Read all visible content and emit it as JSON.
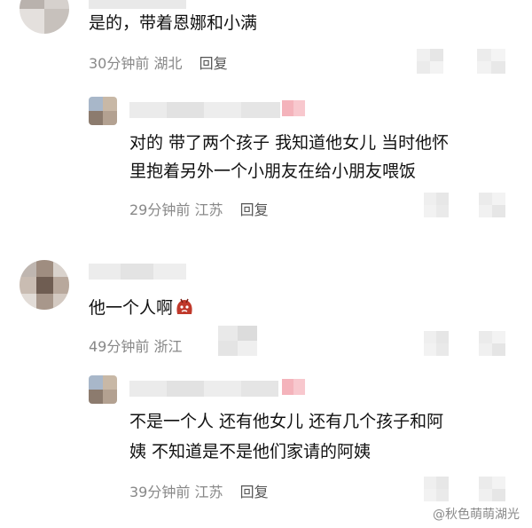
{
  "comments": [
    {
      "text": "是的，带着恩娜和小满",
      "time": "30分钟前",
      "location": "湖北",
      "reply_label": "回复"
    },
    {
      "text_lines": [
        "对的 带了两个孩子 我知道他女儿 当时他怀",
        "里抱着另外一个小朋友在给小朋友喂饭"
      ],
      "time": "29分钟前",
      "location": "江苏",
      "reply_label": "回复"
    },
    {
      "text": "他一个人啊",
      "emoji": "angry-face-emoji",
      "time": "49分钟前",
      "location": "浙江"
    },
    {
      "text_lines": [
        "不是一个人 还有他女儿 还有几个孩子和阿",
        "姨 不知道是不是他们家请的阿姨"
      ],
      "time": "39分钟前",
      "location": "江苏",
      "reply_label": "回复"
    }
  ],
  "watermark": "@秋色萌萌湖光"
}
